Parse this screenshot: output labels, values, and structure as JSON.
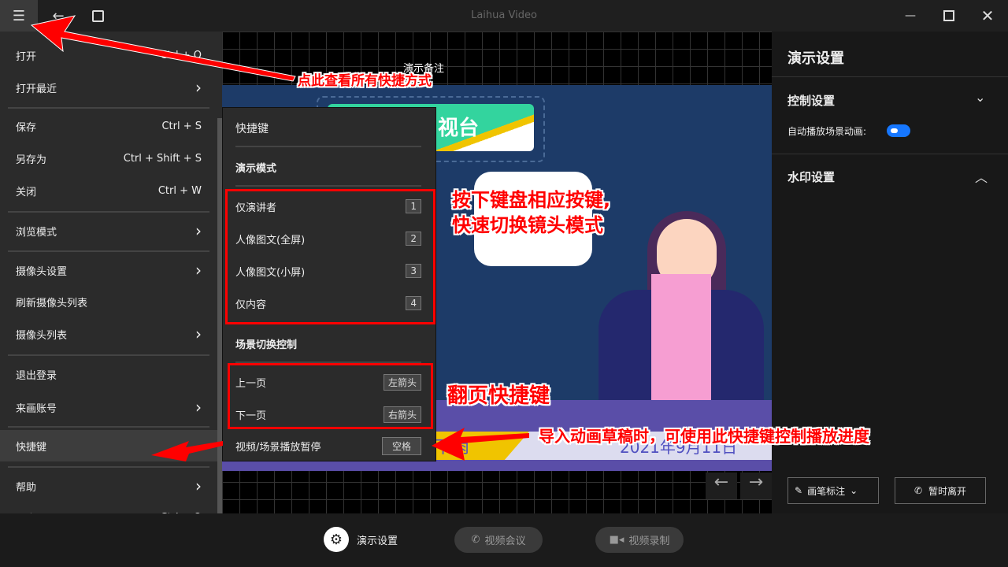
{
  "titlebar": {
    "title": "Laihua Video"
  },
  "canvas": {
    "notes_label": "演示备注",
    "slide_badge": "视台",
    "slide_date": "2021年9月11日",
    "slide_ticker": "下雨"
  },
  "menu": {
    "items": [
      {
        "label": "打开",
        "shortcut": "Ctrl + O"
      },
      {
        "label": "打开最近",
        "submenu": true
      },
      {
        "label": "保存",
        "shortcut": "Ctrl + S"
      },
      {
        "label": "另存为",
        "shortcut": "Ctrl + Shift + S"
      },
      {
        "label": "关闭",
        "shortcut": "Ctrl + W"
      },
      {
        "label": "浏览模式",
        "submenu": true
      },
      {
        "label": "摄像头设置",
        "submenu": true
      },
      {
        "label": "刷新摄像头列表"
      },
      {
        "label": "摄像头列表",
        "submenu": true
      },
      {
        "label": "退出登录"
      },
      {
        "label": "来画账号",
        "submenu": true
      },
      {
        "label": "快捷键",
        "active": true
      },
      {
        "label": "帮助",
        "submenu": true
      },
      {
        "label": "退出",
        "shortcut": "Ctrl + Q"
      }
    ]
  },
  "shortcuts": {
    "title": "快捷键",
    "section1": "演示模式",
    "modes": [
      {
        "label": "仅演讲者",
        "key": "1"
      },
      {
        "label": "人像图文(全屏)",
        "key": "2"
      },
      {
        "label": "人像图文(小屏)",
        "key": "3"
      },
      {
        "label": "仅内容",
        "key": "4"
      }
    ],
    "section2": "场景切换控制",
    "nav": [
      {
        "label": "上一页",
        "key": "左箭头"
      },
      {
        "label": "下一页",
        "key": "右箭头"
      }
    ],
    "play": {
      "label": "视频/场景播放暂停",
      "key": "空格"
    }
  },
  "right": {
    "title": "演示设置",
    "control": "控制设置",
    "auto_play": "自动播放场景动画:",
    "auto_play_on": true,
    "watermark": "水印设置",
    "pen": "画笔标注",
    "leave": "暂时离开"
  },
  "bottom": {
    "settings": "演示设置",
    "meeting": "视频会议",
    "record": "视频录制"
  },
  "annotations": {
    "menu_hint": "点此查看所有快捷方式",
    "mode_hint_1": "按下键盘相应按键,",
    "mode_hint_2": "快速切换镜头模式",
    "page_hint": "翻页快捷键",
    "play_hint": "导入动画草稿时，可使用此快捷键控制播放进度"
  },
  "colors": {
    "accent": "#1677ff",
    "annotation": "#ff0000"
  }
}
